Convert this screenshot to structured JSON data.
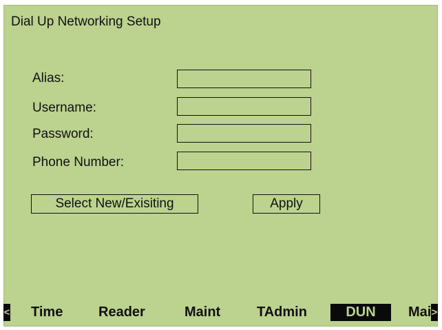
{
  "screen": {
    "title": "Dial Up Networking Setup"
  },
  "form": {
    "alias_label": "Alias:",
    "alias_value": "",
    "username_label": "Username:",
    "username_value": "",
    "password_label": "Password:",
    "password_value": "",
    "phone_label": "Phone Number:",
    "phone_value": ""
  },
  "actions": {
    "select_label": "Select New/Exisiting",
    "apply_label": "Apply"
  },
  "nav": {
    "prev_arrow": "<",
    "next_arrow": ">",
    "tabs": [
      {
        "label": "Time",
        "active": false
      },
      {
        "label": "Reader",
        "active": false
      },
      {
        "label": "Maint",
        "active": false
      },
      {
        "label": "TAdmin",
        "active": false
      },
      {
        "label": "DUN",
        "active": true
      },
      {
        "label": "Mai",
        "active": false
      }
    ]
  },
  "colors": {
    "lcd_background": "#bcd28f",
    "foreground": "#111111",
    "highlight": "#0a0a0a"
  }
}
